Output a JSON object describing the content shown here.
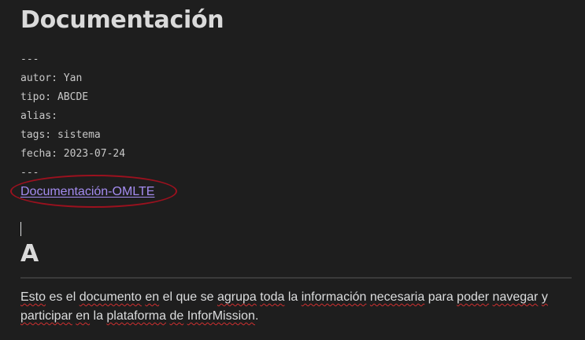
{
  "note": {
    "title": "Documentación",
    "frontmatter": {
      "open_delim": "---",
      "autor": "autor: Yan",
      "tipo": "tipo: ABCDE",
      "alias": "alias:",
      "tags": "tags: sistema",
      "fecha": "fecha: 2023-07-24",
      "close_delim": "---"
    },
    "link": "Documentación-OMLTE",
    "heading": "A",
    "paragraph": {
      "w1": "Esto",
      "t1": " es el ",
      "w2": "documento",
      "t2": " ",
      "w3": "en",
      "t3": " el que se ",
      "w4": "agrupa",
      "t4": " ",
      "w5": "toda",
      "t5": " la ",
      "w6": "información",
      "t6": " ",
      "w7": "necesaria",
      "t7": " para ",
      "w8": "poder",
      "t8": " ",
      "w9": "navegar",
      "t9": " ",
      "w10": "y",
      "t10": " ",
      "w11": "participar",
      "t11": " ",
      "w12": "en",
      "t12": " la ",
      "w13": "plataforma",
      "t13": " ",
      "w14": "de",
      "t14": " ",
      "w15": "InforMission",
      "t15": "."
    }
  },
  "colors": {
    "background": "#1e1e1e",
    "link": "#a48cf0",
    "annotation": "#9b111e",
    "spellcheck": "#d03030"
  }
}
